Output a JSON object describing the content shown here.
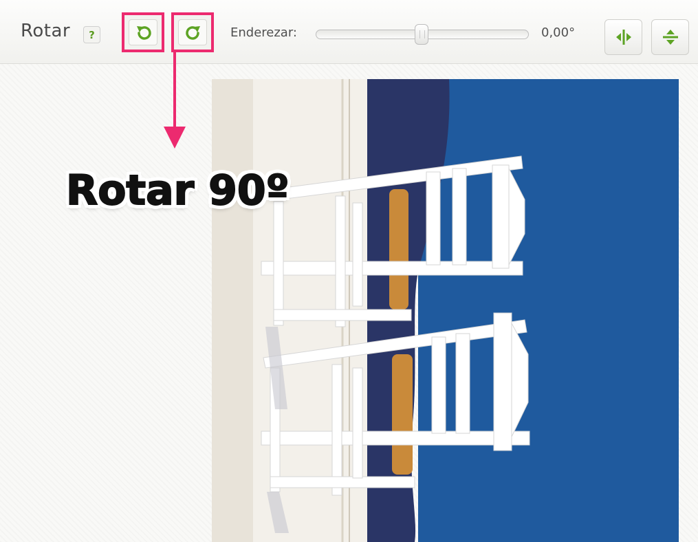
{
  "toolbar": {
    "title": "Rotar",
    "help_label": "?",
    "rotate_left_icon": "rotate-left-icon",
    "rotate_right_icon": "rotate-right-icon",
    "straighten_label": "Enderezar:",
    "straighten_value": "0,00°",
    "straighten_slider_position": 0.5,
    "flip_horizontal_icon": "flip-horizontal-icon",
    "flip_vertical_icon": "flip-vertical-icon"
  },
  "annotation": {
    "text": "Rotar 90º",
    "highlight_color": "#ec2a6f"
  },
  "colors": {
    "accent_green": "#5da324",
    "highlight_pink": "#ec2a6f",
    "sky_blue": "#1f5a9e"
  }
}
